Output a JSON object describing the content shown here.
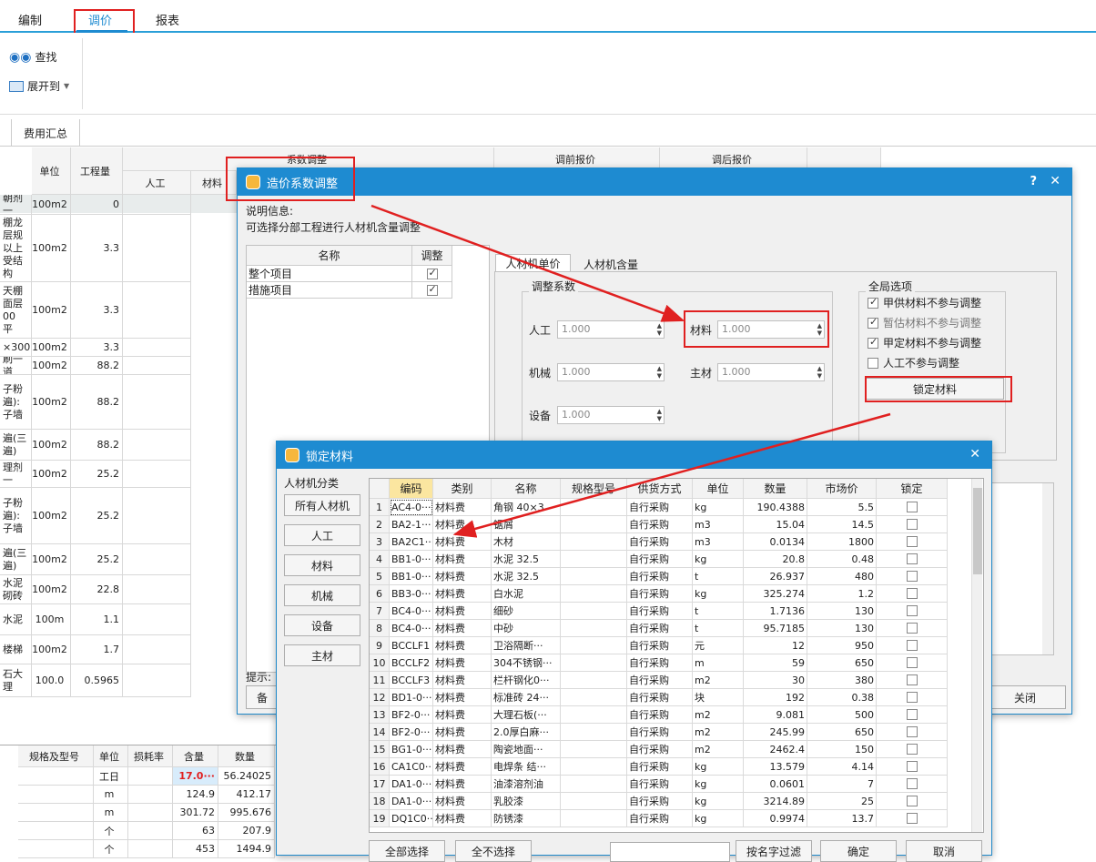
{
  "menubar": {
    "tabs": [
      "编制",
      "调价",
      "报表"
    ]
  },
  "ribbon": {
    "find_label": "查找",
    "expand_label": "展开到"
  },
  "subtabs": {
    "fee_summary": "费用汇总"
  },
  "bgtable": {
    "headers": {
      "unit": "单位",
      "qty": "工程量",
      "coef_adjust": "系数调整",
      "labor": "人工",
      "material": "材料",
      "pre_price": "调前报价",
      "post_price": "调后报价"
    },
    "rows": [
      {
        "name": "朝剂一",
        "unit": "100m2",
        "qty": "0"
      },
      {
        "name": "棚龙 层规 以上 受结构",
        "unit": "100m2",
        "qty": "3.3"
      },
      {
        "name": "天棚 面层 00 平",
        "unit": "100m2",
        "qty": "3.3"
      },
      {
        "name": "×300",
        "unit": "100m2",
        "qty": "3.3"
      },
      {
        "name": "刷一道",
        "unit": "100m2",
        "qty": "88.2"
      },
      {
        "name": "子粉 遍): 子墙",
        "unit": "100m2",
        "qty": "88.2"
      },
      {
        "name": "遍(三 遍)",
        "unit": "100m2",
        "qty": "88.2"
      },
      {
        "name": "理剂一",
        "unit": "100m2",
        "qty": "25.2"
      },
      {
        "name": "子粉 遍): 子墙",
        "unit": "100m2",
        "qty": "25.2"
      },
      {
        "name": "遍(三 遍)",
        "unit": "100m2",
        "qty": "25.2"
      },
      {
        "name": "水泥 砌砖",
        "unit": "100m2",
        "qty": "22.8"
      },
      {
        "name": "水泥",
        "unit": "100m",
        "qty": "1.1"
      },
      {
        "name": "楼梯",
        "unit": "100m2",
        "qty": "1.7"
      },
      {
        "name": "石大理",
        "unit": "100.0",
        "qty": "0.5965"
      }
    ],
    "hint_label": "提示:",
    "back_btn": "备"
  },
  "lowertable": {
    "headers": [
      "规格及型号",
      "单位",
      "损耗率",
      "含量",
      "数量"
    ],
    "rows": [
      [
        "",
        "工日",
        "",
        "17.0···",
        "56.24025"
      ],
      [
        "",
        "m",
        "",
        "124.9",
        "412.17"
      ],
      [
        "",
        "m",
        "",
        "301.72",
        "995.676"
      ],
      [
        "",
        "个",
        "",
        "63",
        "207.9"
      ],
      [
        "",
        "个",
        "",
        "453",
        "1494.9"
      ]
    ]
  },
  "dialog1": {
    "title": "造价系数调整",
    "help": "?",
    "close": "✕",
    "info_label": "说明信息:",
    "info_text": "可选择分部工程进行人材机含量调整",
    "tree_headers": {
      "name": "名称",
      "adjust": "调整"
    },
    "tree_rows": [
      "整个项目",
      "措施项目"
    ],
    "tabs": [
      "人材机单价",
      "人材机含量"
    ],
    "coef_group": "调整系数",
    "fields": {
      "labor": {
        "label": "人工",
        "value": "1.000"
      },
      "material": {
        "label": "材料",
        "value": "1.000"
      },
      "machine": {
        "label": "机械",
        "value": "1.000"
      },
      "main_material": {
        "label": "主材",
        "value": "1.000"
      },
      "equipment": {
        "label": "设备",
        "value": "1.000"
      }
    },
    "global_group": "全局选项",
    "global_options": [
      {
        "label": "甲供材料不参与调整",
        "checked": true
      },
      {
        "label": "暂估材料不参与调整",
        "checked": true
      },
      {
        "label": "甲定材料不参与调整",
        "checked": true
      },
      {
        "label": "人工不参与调整",
        "checked": false
      }
    ],
    "lock_btn": "锁定材料",
    "close_btn": "关闭"
  },
  "dialog2": {
    "title": "锁定材料",
    "close": "✕",
    "category_label": "人材机分类",
    "categories": [
      "所有人材机",
      "人工",
      "材料",
      "机械",
      "设备",
      "主材"
    ],
    "headers": [
      "编码",
      "类别",
      "名称",
      "规格型号",
      "供货方式",
      "单位",
      "数量",
      "市场价",
      "锁定"
    ],
    "rows": [
      [
        "1",
        "AC4-0···",
        "材料费",
        "角钢 40×3",
        "",
        "自行采购",
        "kg",
        "190.4388",
        "5.5"
      ],
      [
        "2",
        "BA2-1···",
        "材料费",
        "锯屑",
        "",
        "自行采购",
        "m3",
        "15.04",
        "14.5"
      ],
      [
        "3",
        "BA2C1···",
        "材料费",
        "木材",
        "",
        "自行采购",
        "m3",
        "0.0134",
        "1800"
      ],
      [
        "4",
        "BB1-0···",
        "材料费",
        "水泥 32.5",
        "",
        "自行采购",
        "kg",
        "20.8",
        "0.48"
      ],
      [
        "5",
        "BB1-0···",
        "材料费",
        "水泥 32.5",
        "",
        "自行采购",
        "t",
        "26.937",
        "480"
      ],
      [
        "6",
        "BB3-0···",
        "材料费",
        "白水泥",
        "",
        "自行采购",
        "kg",
        "325.274",
        "1.2"
      ],
      [
        "7",
        "BC4-0···",
        "材料费",
        "细砂",
        "",
        "自行采购",
        "t",
        "1.7136",
        "130"
      ],
      [
        "8",
        "BC4-0···",
        "材料费",
        "中砂",
        "",
        "自行采购",
        "t",
        "95.7185",
        "130"
      ],
      [
        "9",
        "BCCLF1",
        "材料费",
        "卫浴隔断···",
        "",
        "自行采购",
        "元",
        "12",
        "950"
      ],
      [
        "10",
        "BCCLF2",
        "材料费",
        "304不锈钢···",
        "",
        "自行采购",
        "m",
        "59",
        "650"
      ],
      [
        "11",
        "BCCLF3",
        "材料费",
        "栏杆钢化0···",
        "",
        "自行采购",
        "m2",
        "30",
        "380"
      ],
      [
        "12",
        "BD1-0···",
        "材料费",
        "标准砖 24···",
        "",
        "自行采购",
        "块",
        "192",
        "0.38"
      ],
      [
        "13",
        "BF2-0···",
        "材料费",
        "大理石板(···",
        "",
        "自行采购",
        "m2",
        "9.081",
        "500"
      ],
      [
        "14",
        "BF2-0···",
        "材料费",
        "2.0厚白麻···",
        "",
        "自行采购",
        "m2",
        "245.99",
        "650"
      ],
      [
        "15",
        "BG1-0···",
        "材料费",
        "陶瓷地面···",
        "",
        "自行采购",
        "m2",
        "2462.4",
        "150"
      ],
      [
        "16",
        "CA1C0···",
        "材料费",
        "电焊条 结···",
        "",
        "自行采购",
        "kg",
        "13.579",
        "4.14"
      ],
      [
        "17",
        "DA1-0···",
        "材料费",
        "油漆溶剂油",
        "",
        "自行采购",
        "kg",
        "0.0601",
        "7"
      ],
      [
        "18",
        "DA1-0···",
        "材料费",
        "乳胶漆",
        "",
        "自行采购",
        "kg",
        "3214.89",
        "25"
      ],
      [
        "19",
        "DQ1C0···",
        "材料费",
        "防锈漆",
        "",
        "自行采购",
        "kg",
        "0.9974",
        "13.7"
      ]
    ],
    "select_all": "全部选择",
    "select_none": "全不选择",
    "filter_btn": "按名字过滤",
    "ok_btn": "确定",
    "cancel_btn": "取消"
  }
}
